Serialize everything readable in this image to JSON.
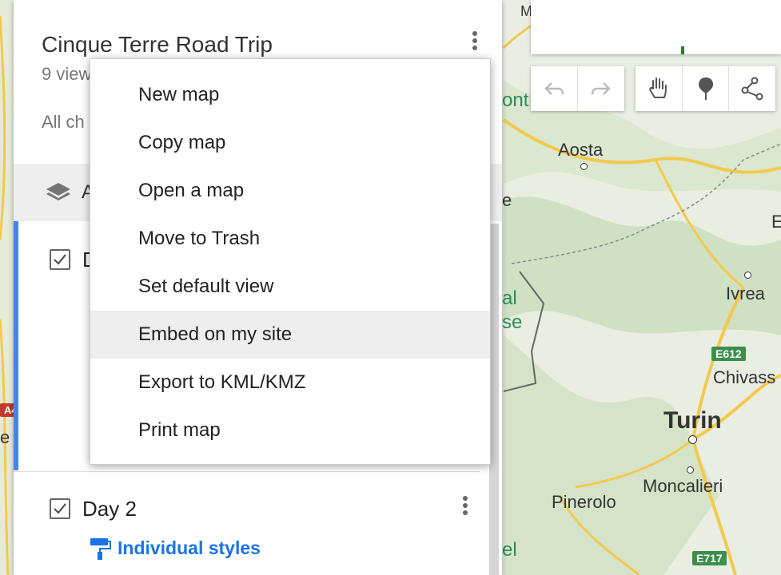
{
  "map": {
    "labels": {
      "aosta": "Aosta",
      "ivrea": "Ivrea",
      "chivasso": "Chivass",
      "turin": "Turin",
      "moncalieri": "Moncalieri",
      "pinerolo": "Pinerolo",
      "top_fragment": "M",
      "nt_fragment": "ont",
      "al_fragment": "al",
      "se_fragment": "se",
      "e_fragment": "e",
      "el_fragment": "el",
      "left_e_fragment": "e",
      "e_right_fragment": "E"
    },
    "badges": {
      "e612": "E612",
      "e717": "E717",
      "a4": "A4"
    }
  },
  "panel": {
    "title": "Cinque Terre Road Trip",
    "views": "9 view",
    "all_changes": "All ch",
    "base_layer_label": "A",
    "day1_label": "D",
    "day2_label": "Day 2",
    "styles_link": "Individual styles"
  },
  "menu": {
    "items": [
      {
        "label": "New map"
      },
      {
        "label": "Copy map"
      },
      {
        "label": "Open a map"
      },
      {
        "label": "Move to Trash"
      },
      {
        "label": "Set default view"
      },
      {
        "label": "Embed on my site"
      },
      {
        "label": "Export to KML/KMZ"
      },
      {
        "label": "Print map"
      }
    ]
  },
  "colors": {
    "accent_blue": "#4285f4",
    "link_blue": "#1a73e8",
    "road_green": "#3c8f4a"
  }
}
